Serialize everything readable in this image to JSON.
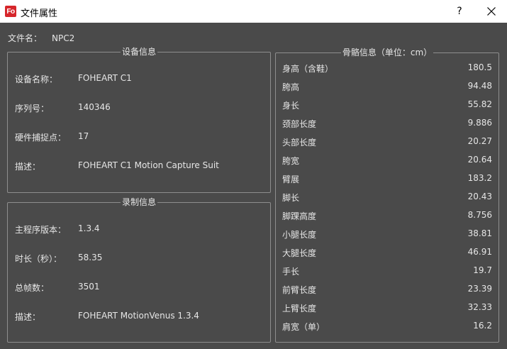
{
  "window": {
    "icon_text": "Fo",
    "title": "文件属性",
    "help_label": "?"
  },
  "file": {
    "label": "文件名：",
    "value": "NPC2"
  },
  "device": {
    "title": "设备信息",
    "rows": [
      {
        "label": "设备名称：",
        "value": "FOHEART C1"
      },
      {
        "label": "序列号：",
        "value": "140346"
      },
      {
        "label": "硬件捕捉点：",
        "value": "17"
      },
      {
        "label": "描述：",
        "value": "FOHEART C1 Motion Capture Suit"
      }
    ]
  },
  "record": {
    "title": "录制信息",
    "rows": [
      {
        "label": "主程序版本：",
        "value": "1.3.4"
      },
      {
        "label": "时长（秒）：",
        "value": "58.35"
      },
      {
        "label": "总帧数：",
        "value": "3501"
      },
      {
        "label": "描述：",
        "value": "FOHEART MotionVenus 1.3.4"
      }
    ]
  },
  "bone": {
    "title": "骨骼信息（单位：cm）",
    "rows": [
      {
        "label": "身高（含鞋）",
        "value": "180.5"
      },
      {
        "label": "胯高",
        "value": "94.48"
      },
      {
        "label": "身长",
        "value": "55.82"
      },
      {
        "label": "颈部长度",
        "value": "9.886"
      },
      {
        "label": "头部长度",
        "value": "20.27"
      },
      {
        "label": "胯宽",
        "value": "20.64"
      },
      {
        "label": "臂展",
        "value": "183.2"
      },
      {
        "label": "脚长",
        "value": "20.43"
      },
      {
        "label": "脚踝高度",
        "value": "8.756"
      },
      {
        "label": "小腿长度",
        "value": "38.81"
      },
      {
        "label": "大腿长度",
        "value": "46.91"
      },
      {
        "label": "手长",
        "value": "19.7"
      },
      {
        "label": "前臂长度",
        "value": "23.39"
      },
      {
        "label": "上臂长度",
        "value": "32.33"
      },
      {
        "label": "肩宽（单）",
        "value": "16.2"
      }
    ]
  }
}
